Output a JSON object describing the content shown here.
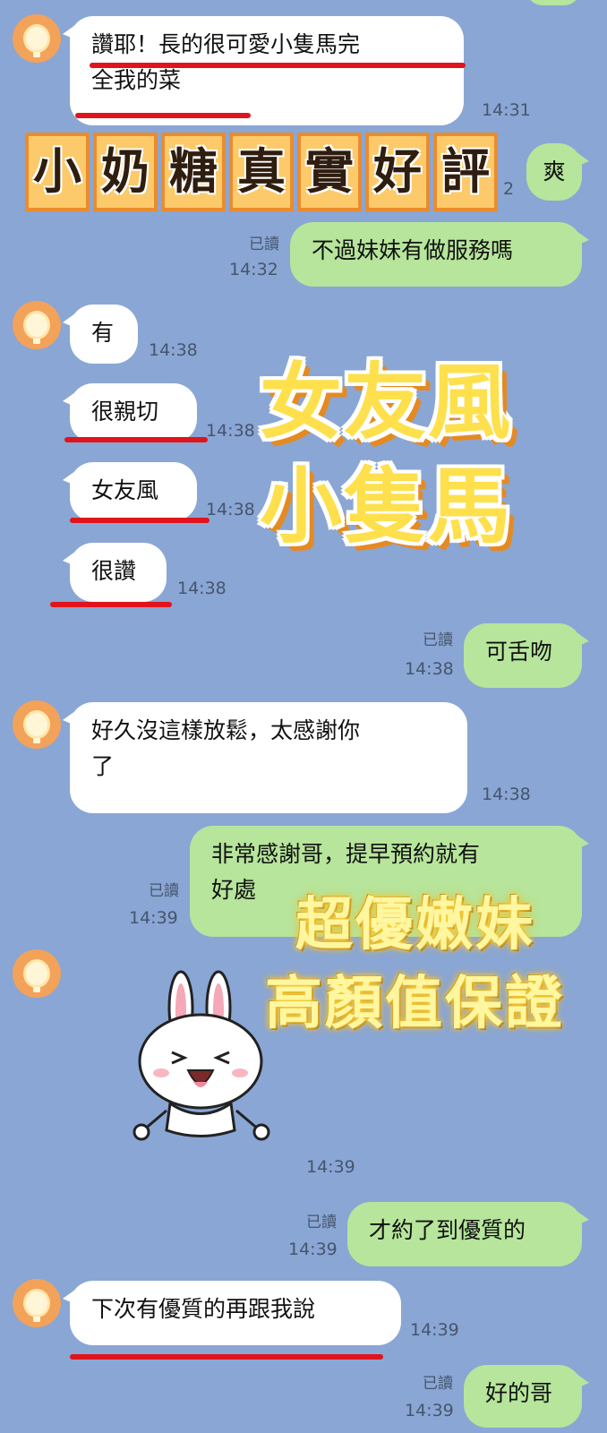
{
  "messages": [
    {
      "id": "m1",
      "text_line1": "讚耶！長的很可愛小隻馬完",
      "text_line2": "全我的菜",
      "time": "14:31"
    },
    {
      "id": "m2",
      "text": "爽",
      "time_partial": "2"
    },
    {
      "id": "m3",
      "text": "不過妹妹有做服務嗎",
      "read": "已讀",
      "time": "14:32"
    },
    {
      "id": "m4",
      "text": "有",
      "time": "14:38"
    },
    {
      "id": "m5",
      "text": "很親切",
      "time": "14:38"
    },
    {
      "id": "m6",
      "text": "女友風",
      "time": "14:38"
    },
    {
      "id": "m7",
      "text": "很讚",
      "time": "14:38"
    },
    {
      "id": "m8",
      "text": "可舌吻",
      "read": "已讀",
      "time": "14:38"
    },
    {
      "id": "m9",
      "text_line1": "好久沒這樣放鬆，太感謝你",
      "text_line2": "了",
      "time": "14:38"
    },
    {
      "id": "m10",
      "text_line1": "非常感謝哥，提早預約就有",
      "text_line2": "好處",
      "read": "已讀",
      "time": "14:39"
    },
    {
      "id": "m11",
      "sticker": "bunny-sticker",
      "time": "14:39"
    },
    {
      "id": "m12",
      "text": "才約了到優質的",
      "read": "已讀",
      "time": "14:39"
    },
    {
      "id": "m13",
      "text": "下次有優質的再跟我說",
      "time": "14:39"
    },
    {
      "id": "m14",
      "text": "好的哥",
      "read": "已讀",
      "time": "14:39"
    }
  ],
  "overlays": {
    "banner_chars": [
      "小",
      "奶",
      "糖",
      "真",
      "實",
      "好",
      "評"
    ],
    "big_line1": "女友風",
    "big_line2": "小隻馬",
    "glow_line1": "超優嫩妹",
    "glow_line2": "高顏值保證"
  },
  "colors": {
    "background": "#8aa6d4",
    "incoming_bubble": "#ffffff",
    "outgoing_bubble": "#b6e59b",
    "underline": "#e0141c"
  },
  "icons": {
    "avatar": "lightbulb-avatar-icon"
  }
}
